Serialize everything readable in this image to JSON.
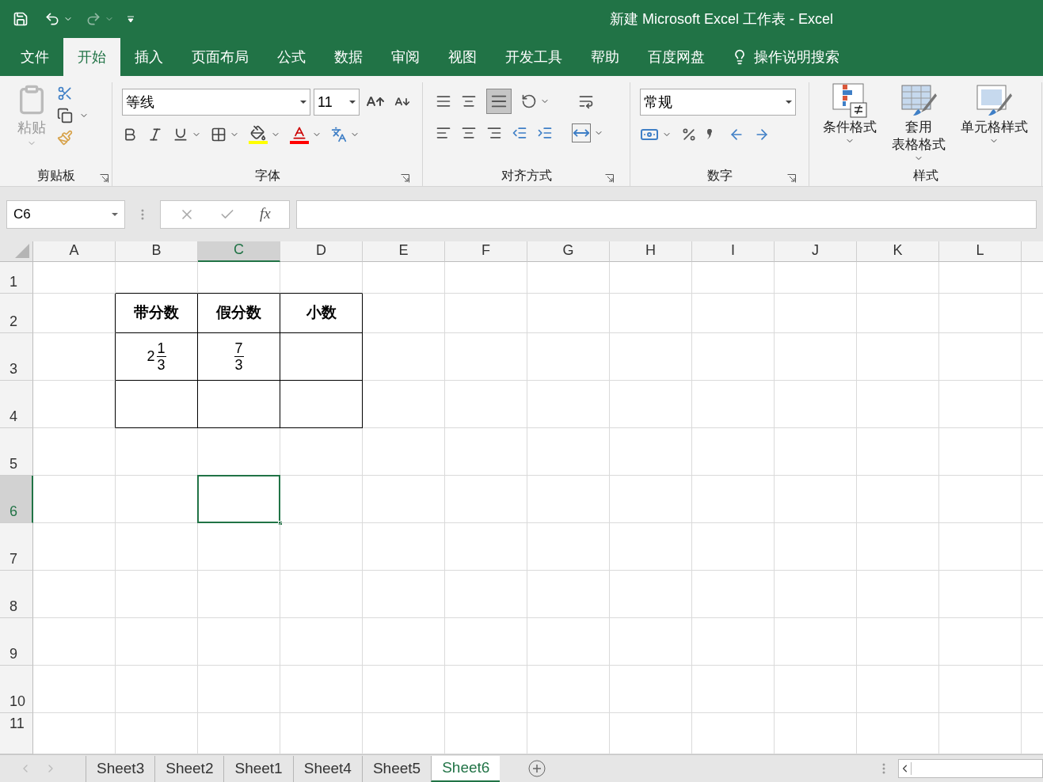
{
  "title_bar": {
    "title": "新建 Microsoft Excel 工作表  -  Excel"
  },
  "menu_tabs": [
    {
      "label": "文件",
      "selected": false
    },
    {
      "label": "开始",
      "selected": true
    },
    {
      "label": "插入",
      "selected": false
    },
    {
      "label": "页面布局",
      "selected": false
    },
    {
      "label": "公式",
      "selected": false
    },
    {
      "label": "数据",
      "selected": false
    },
    {
      "label": "审阅",
      "selected": false
    },
    {
      "label": "视图",
      "selected": false
    },
    {
      "label": "开发工具",
      "selected": false
    },
    {
      "label": "帮助",
      "selected": false
    },
    {
      "label": "百度网盘",
      "selected": false
    }
  ],
  "tell_me": "操作说明搜索",
  "ribbon": {
    "clipboard": {
      "paste": "粘贴",
      "label": "剪贴板"
    },
    "font": {
      "font_name": "等线",
      "font_size": "11",
      "label": "字体"
    },
    "alignment": {
      "label": "对齐方式"
    },
    "number": {
      "format": "常规",
      "label": "数字"
    },
    "styles": {
      "buttons": [
        {
          "kind": "conditional",
          "lines": [
            "条件格式"
          ]
        },
        {
          "kind": "table",
          "lines": [
            "套用",
            "表格格式"
          ]
        },
        {
          "kind": "cell",
          "lines": [
            "单元格样式"
          ]
        }
      ],
      "label": "样式"
    }
  },
  "formula_bar": {
    "name_box": "C6",
    "function_button": "fx"
  },
  "grid": {
    "columns": [
      {
        "label": "A",
        "selected": false
      },
      {
        "label": "B",
        "selected": false
      },
      {
        "label": "C",
        "selected": true
      },
      {
        "label": "D",
        "selected": false
      },
      {
        "label": "E",
        "selected": false
      },
      {
        "label": "F",
        "selected": false
      },
      {
        "label": "G",
        "selected": false
      },
      {
        "label": "H",
        "selected": false
      },
      {
        "label": "I",
        "selected": false
      },
      {
        "label": "J",
        "selected": false
      },
      {
        "label": "K",
        "selected": false
      },
      {
        "label": "L",
        "selected": false
      }
    ],
    "rows": [
      {
        "label": "1",
        "selected": false
      },
      {
        "label": "2",
        "selected": false
      },
      {
        "label": "3",
        "selected": false
      },
      {
        "label": "4",
        "selected": false
      },
      {
        "label": "5",
        "selected": false
      },
      {
        "label": "6",
        "selected": true
      },
      {
        "label": "7",
        "selected": false
      },
      {
        "label": "8",
        "selected": false
      },
      {
        "label": "9",
        "selected": false
      },
      {
        "label": "10",
        "selected": false
      },
      {
        "label": "11",
        "selected": false
      }
    ],
    "table": [
      [
        {
          "kind": "text",
          "text": "带分数"
        },
        {
          "kind": "text",
          "text": "假分数"
        },
        {
          "kind": "text",
          "text": "小数"
        }
      ],
      [
        {
          "kind": "mixed",
          "whole": "2",
          "numerator": "1",
          "denominator": "3"
        },
        {
          "kind": "fraction",
          "numerator": "7",
          "denominator": "3"
        },
        {
          "kind": "blank"
        }
      ],
      [
        {
          "kind": "blank"
        },
        {
          "kind": "blank"
        },
        {
          "kind": "blank"
        }
      ]
    ]
  },
  "sheet_tabs": [
    {
      "label": "Sheet3",
      "selected": false
    },
    {
      "label": "Sheet2",
      "selected": false
    },
    {
      "label": "Sheet1",
      "selected": false
    },
    {
      "label": "Sheet4",
      "selected": false
    },
    {
      "label": "Sheet5",
      "selected": false
    },
    {
      "label": "Sheet6",
      "selected": true
    }
  ]
}
